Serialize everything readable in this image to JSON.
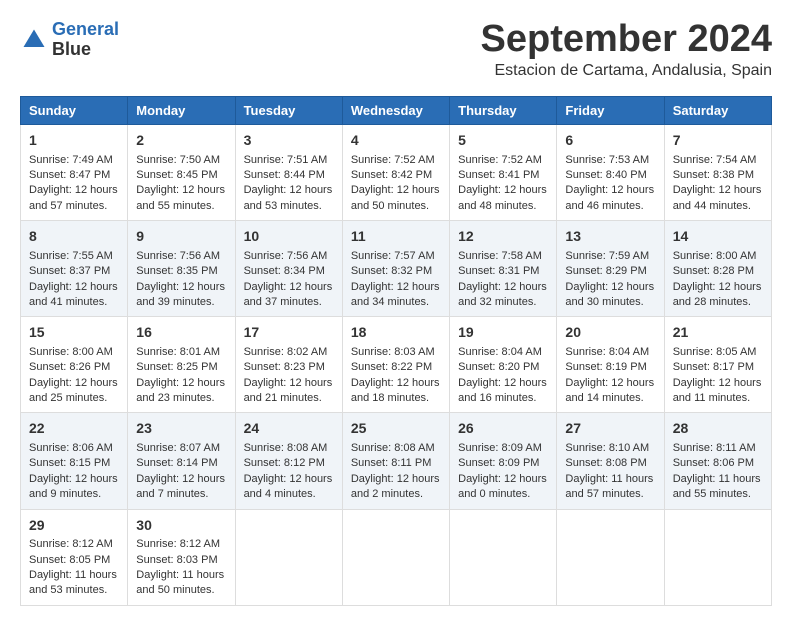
{
  "header": {
    "logo_line1": "General",
    "logo_line2": "Blue",
    "month": "September 2024",
    "location": "Estacion de Cartama, Andalusia, Spain"
  },
  "days_of_week": [
    "Sunday",
    "Monday",
    "Tuesday",
    "Wednesday",
    "Thursday",
    "Friday",
    "Saturday"
  ],
  "weeks": [
    [
      {
        "day": "1",
        "sunrise": "Sunrise: 7:49 AM",
        "sunset": "Sunset: 8:47 PM",
        "daylight": "Daylight: 12 hours and 57 minutes."
      },
      {
        "day": "2",
        "sunrise": "Sunrise: 7:50 AM",
        "sunset": "Sunset: 8:45 PM",
        "daylight": "Daylight: 12 hours and 55 minutes."
      },
      {
        "day": "3",
        "sunrise": "Sunrise: 7:51 AM",
        "sunset": "Sunset: 8:44 PM",
        "daylight": "Daylight: 12 hours and 53 minutes."
      },
      {
        "day": "4",
        "sunrise": "Sunrise: 7:52 AM",
        "sunset": "Sunset: 8:42 PM",
        "daylight": "Daylight: 12 hours and 50 minutes."
      },
      {
        "day": "5",
        "sunrise": "Sunrise: 7:52 AM",
        "sunset": "Sunset: 8:41 PM",
        "daylight": "Daylight: 12 hours and 48 minutes."
      },
      {
        "day": "6",
        "sunrise": "Sunrise: 7:53 AM",
        "sunset": "Sunset: 8:40 PM",
        "daylight": "Daylight: 12 hours and 46 minutes."
      },
      {
        "day": "7",
        "sunrise": "Sunrise: 7:54 AM",
        "sunset": "Sunset: 8:38 PM",
        "daylight": "Daylight: 12 hours and 44 minutes."
      }
    ],
    [
      {
        "day": "8",
        "sunrise": "Sunrise: 7:55 AM",
        "sunset": "Sunset: 8:37 PM",
        "daylight": "Daylight: 12 hours and 41 minutes."
      },
      {
        "day": "9",
        "sunrise": "Sunrise: 7:56 AM",
        "sunset": "Sunset: 8:35 PM",
        "daylight": "Daylight: 12 hours and 39 minutes."
      },
      {
        "day": "10",
        "sunrise": "Sunrise: 7:56 AM",
        "sunset": "Sunset: 8:34 PM",
        "daylight": "Daylight: 12 hours and 37 minutes."
      },
      {
        "day": "11",
        "sunrise": "Sunrise: 7:57 AM",
        "sunset": "Sunset: 8:32 PM",
        "daylight": "Daylight: 12 hours and 34 minutes."
      },
      {
        "day": "12",
        "sunrise": "Sunrise: 7:58 AM",
        "sunset": "Sunset: 8:31 PM",
        "daylight": "Daylight: 12 hours and 32 minutes."
      },
      {
        "day": "13",
        "sunrise": "Sunrise: 7:59 AM",
        "sunset": "Sunset: 8:29 PM",
        "daylight": "Daylight: 12 hours and 30 minutes."
      },
      {
        "day": "14",
        "sunrise": "Sunrise: 8:00 AM",
        "sunset": "Sunset: 8:28 PM",
        "daylight": "Daylight: 12 hours and 28 minutes."
      }
    ],
    [
      {
        "day": "15",
        "sunrise": "Sunrise: 8:00 AM",
        "sunset": "Sunset: 8:26 PM",
        "daylight": "Daylight: 12 hours and 25 minutes."
      },
      {
        "day": "16",
        "sunrise": "Sunrise: 8:01 AM",
        "sunset": "Sunset: 8:25 PM",
        "daylight": "Daylight: 12 hours and 23 minutes."
      },
      {
        "day": "17",
        "sunrise": "Sunrise: 8:02 AM",
        "sunset": "Sunset: 8:23 PM",
        "daylight": "Daylight: 12 hours and 21 minutes."
      },
      {
        "day": "18",
        "sunrise": "Sunrise: 8:03 AM",
        "sunset": "Sunset: 8:22 PM",
        "daylight": "Daylight: 12 hours and 18 minutes."
      },
      {
        "day": "19",
        "sunrise": "Sunrise: 8:04 AM",
        "sunset": "Sunset: 8:20 PM",
        "daylight": "Daylight: 12 hours and 16 minutes."
      },
      {
        "day": "20",
        "sunrise": "Sunrise: 8:04 AM",
        "sunset": "Sunset: 8:19 PM",
        "daylight": "Daylight: 12 hours and 14 minutes."
      },
      {
        "day": "21",
        "sunrise": "Sunrise: 8:05 AM",
        "sunset": "Sunset: 8:17 PM",
        "daylight": "Daylight: 12 hours and 11 minutes."
      }
    ],
    [
      {
        "day": "22",
        "sunrise": "Sunrise: 8:06 AM",
        "sunset": "Sunset: 8:15 PM",
        "daylight": "Daylight: 12 hours and 9 minutes."
      },
      {
        "day": "23",
        "sunrise": "Sunrise: 8:07 AM",
        "sunset": "Sunset: 8:14 PM",
        "daylight": "Daylight: 12 hours and 7 minutes."
      },
      {
        "day": "24",
        "sunrise": "Sunrise: 8:08 AM",
        "sunset": "Sunset: 8:12 PM",
        "daylight": "Daylight: 12 hours and 4 minutes."
      },
      {
        "day": "25",
        "sunrise": "Sunrise: 8:08 AM",
        "sunset": "Sunset: 8:11 PM",
        "daylight": "Daylight: 12 hours and 2 minutes."
      },
      {
        "day": "26",
        "sunrise": "Sunrise: 8:09 AM",
        "sunset": "Sunset: 8:09 PM",
        "daylight": "Daylight: 12 hours and 0 minutes."
      },
      {
        "day": "27",
        "sunrise": "Sunrise: 8:10 AM",
        "sunset": "Sunset: 8:08 PM",
        "daylight": "Daylight: 11 hours and 57 minutes."
      },
      {
        "day": "28",
        "sunrise": "Sunrise: 8:11 AM",
        "sunset": "Sunset: 8:06 PM",
        "daylight": "Daylight: 11 hours and 55 minutes."
      }
    ],
    [
      {
        "day": "29",
        "sunrise": "Sunrise: 8:12 AM",
        "sunset": "Sunset: 8:05 PM",
        "daylight": "Daylight: 11 hours and 53 minutes."
      },
      {
        "day": "30",
        "sunrise": "Sunrise: 8:12 AM",
        "sunset": "Sunset: 8:03 PM",
        "daylight": "Daylight: 11 hours and 50 minutes."
      },
      null,
      null,
      null,
      null,
      null
    ]
  ]
}
